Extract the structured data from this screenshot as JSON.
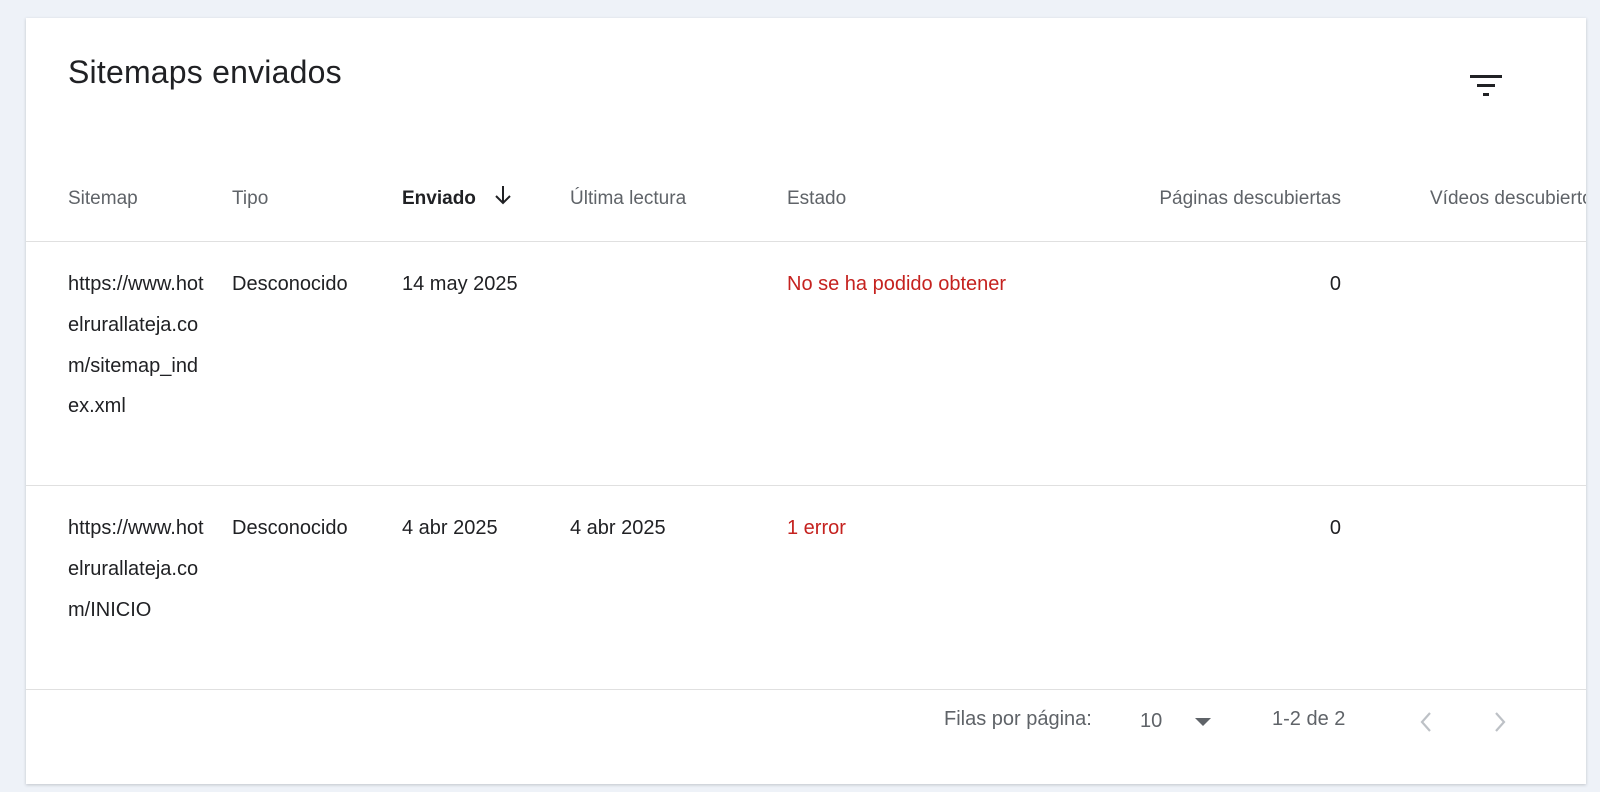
{
  "card": {
    "title": "Sitemaps enviados"
  },
  "icons": {
    "filter": "filter-list-icon",
    "sort": "arrow-down-icon",
    "caret": "caret-down-icon",
    "prev": "chevron-left-icon",
    "next": "chevron-right-icon"
  },
  "table": {
    "columns": {
      "sitemap": "Sitemap",
      "tipo": "Tipo",
      "enviado": "Enviado",
      "ultima_lectura": "Última lectura",
      "estado": "Estado",
      "paginas": "Páginas descubiertas",
      "videos": "Vídeos descubiertos"
    },
    "rows": [
      {
        "sitemap": "https://www.hotelrurallateja.com/sitemap_index.xml",
        "tipo": "Desconocido",
        "enviado": "14 may 2025",
        "ultima_lectura": "",
        "estado": "No se ha podido obtener",
        "paginas": "0",
        "videos": ""
      },
      {
        "sitemap": "https://www.hotelrurallateja.com/INICIO",
        "tipo": "Desconocido",
        "enviado": "4 abr 2025",
        "ultima_lectura": "4 abr 2025",
        "estado": "1 error",
        "paginas": "0",
        "videos": ""
      }
    ]
  },
  "pagination": {
    "rows_label": "Filas por página:",
    "rows_value": "10",
    "range": "1-2 de 2"
  },
  "colors": {
    "background": "#eef2f8",
    "card": "#ffffff",
    "text": "#202124",
    "muted": "#5f6368",
    "error": "#c5221f",
    "divider": "#e0e0e0",
    "disabled_icon": "#bdc1c6"
  }
}
